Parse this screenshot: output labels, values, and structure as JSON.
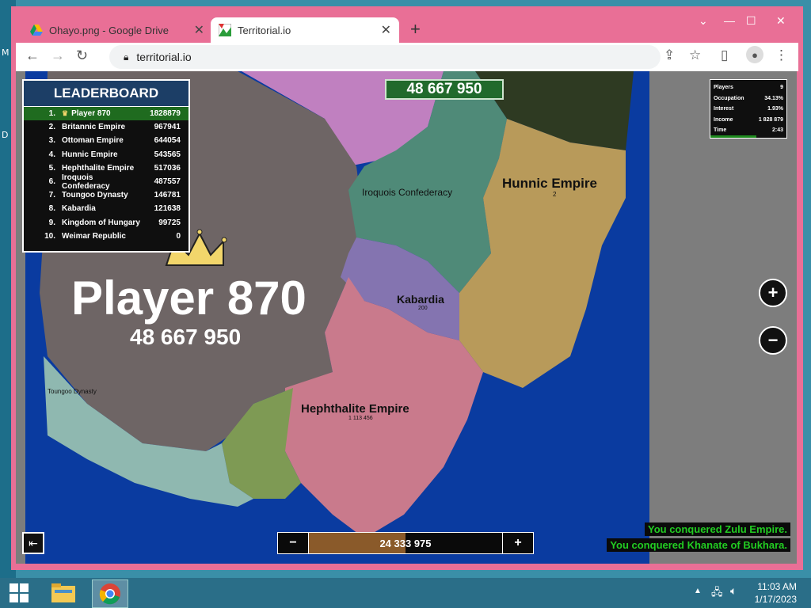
{
  "browser": {
    "tabs": [
      {
        "title": "Ohayo.png - Google Drive"
      },
      {
        "title": "Territorial.io"
      }
    ],
    "url": "territorial.io"
  },
  "game": {
    "leaderboard": {
      "title": "LEADERBOARD",
      "rows": [
        {
          "rank": "1.",
          "name": "Player 870",
          "score": "1828879"
        },
        {
          "rank": "2.",
          "name": "Britannic Empire",
          "score": "967941"
        },
        {
          "rank": "3.",
          "name": "Ottoman Empire",
          "score": "644054"
        },
        {
          "rank": "4.",
          "name": "Hunnic Empire",
          "score": "543565"
        },
        {
          "rank": "5.",
          "name": "Hephthalite Empire",
          "score": "517036"
        },
        {
          "rank": "6.",
          "name": "Iroquois Confederacy",
          "score": "487557"
        },
        {
          "rank": "7.",
          "name": "Toungoo Dynasty",
          "score": "146781"
        },
        {
          "rank": "8.",
          "name": "Kabardia",
          "score": "121638"
        },
        {
          "rank": "9.",
          "name": "Kingdom of Hungary",
          "score": "99725"
        },
        {
          "rank": "10.",
          "name": "Weimar Republic",
          "score": "0"
        }
      ]
    },
    "top_balance": "48 667 950",
    "stats": [
      {
        "label": "Players",
        "value": "9"
      },
      {
        "label": "Occupation",
        "value": "34.13%"
      },
      {
        "label": "Interest",
        "value": "1.93%"
      },
      {
        "label": "Income",
        "value": "1 828 879"
      },
      {
        "label": "Time",
        "value": "2:43"
      }
    ],
    "player": {
      "name": "Player 870",
      "balance": "48 667 950"
    },
    "territories": [
      {
        "name": "Iroquois Confederacy",
        "sub": ""
      },
      {
        "name": "Hunnic Empire",
        "sub": "2"
      },
      {
        "name": "Kabardia",
        "sub": "200"
      },
      {
        "name": "Hephthalite Empire",
        "sub": "1 113 456"
      },
      {
        "name": "Toungoo Dynasty",
        "sub": ""
      }
    ],
    "attack_slider": {
      "value": "24 333 975",
      "minus": "−",
      "plus": "+",
      "fraction": 0.5
    },
    "messages": [
      "You conquered Zulu Empire.",
      "You conquered Khanate of Bukhara."
    ],
    "colors": {
      "player": "#6e6565",
      "ocean": "#0a3ba0",
      "hunnic": "#b89a5a",
      "hephthalite": "#c97a8c",
      "iroquois": "#4f8a78",
      "kabardia": "#8474b0",
      "toungoo": "#8fb8b0",
      "pink": "#c080c0",
      "olive": "#7e9a54"
    }
  },
  "desktop": {
    "labels": [
      "M",
      "D"
    ],
    "clock_time": "11:03 AM",
    "clock_date": "1/17/2023"
  }
}
